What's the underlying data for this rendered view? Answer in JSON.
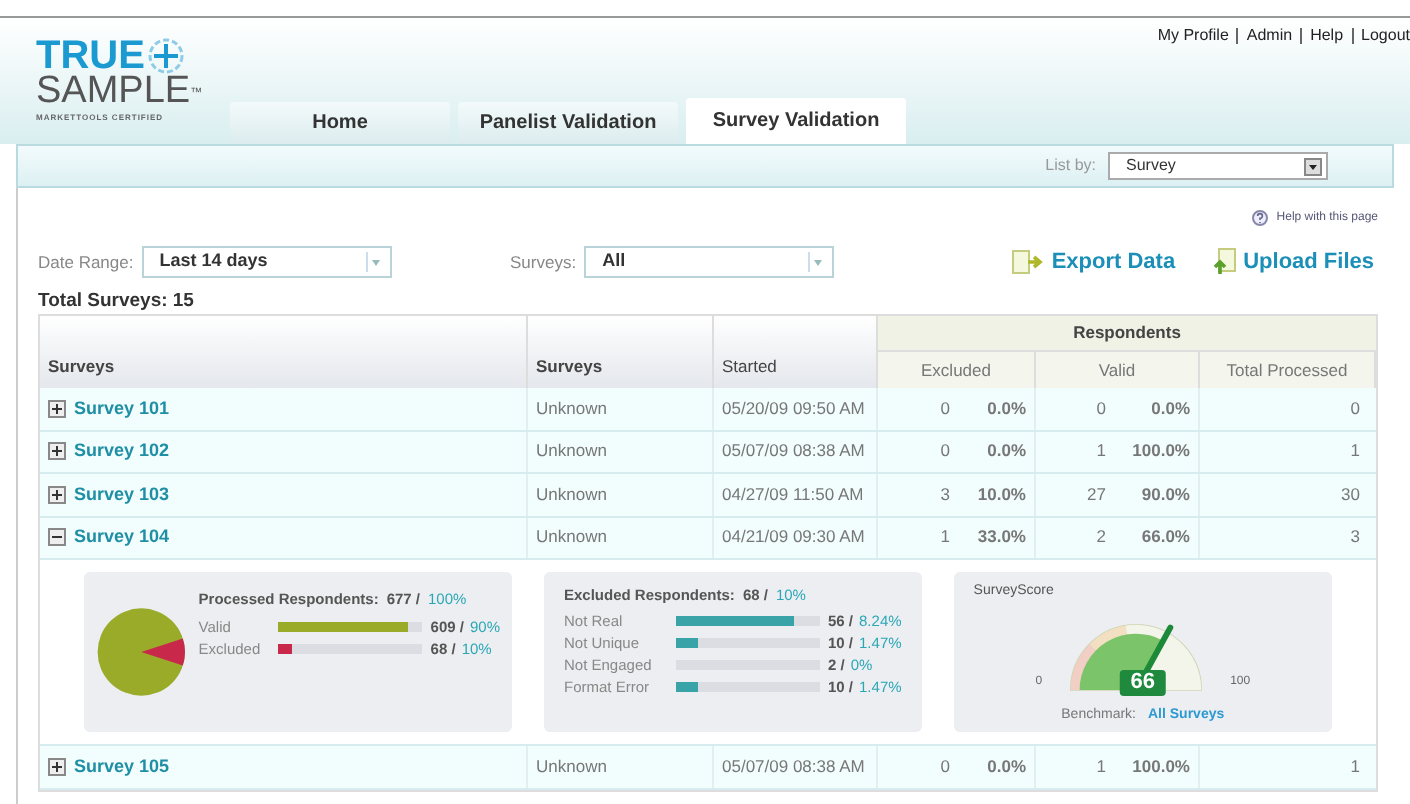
{
  "logo": {
    "line1": "TRUE",
    "line2": "SAMPLE",
    "mark": "™",
    "tagline": "MARKETTOOLS CERTIFIED"
  },
  "top_links": [
    "My Profile",
    "Admin",
    "Help",
    "Logout"
  ],
  "tabs": [
    {
      "label": "Home",
      "selected": false
    },
    {
      "label": "Panelist Validation",
      "selected": false
    },
    {
      "label": "Survey Validation",
      "selected": true
    }
  ],
  "list_by": {
    "label": "List by:",
    "value": "Survey"
  },
  "help_link": "Help with this page",
  "filters": [
    {
      "label": "Date Range:",
      "value": "Last 14 days"
    },
    {
      "label": "Surveys:",
      "value": "All"
    }
  ],
  "actions": [
    {
      "label": "Export Data",
      "kind": "export"
    },
    {
      "label": "Upload Files",
      "kind": "upload"
    }
  ],
  "total": "Total Surveys: 15",
  "table": {
    "columns": [
      "Surveys",
      "Surveys",
      "Started"
    ],
    "group": "Respondents",
    "sub_columns": [
      "Excluded",
      "Valid",
      "Total Processed"
    ],
    "rows": [
      {
        "name": "Survey 101",
        "status": "Unknown",
        "started": "05/20/09 09:50 AM",
        "excluded": "0",
        "excluded_pct": "0.0%",
        "valid": "0",
        "valid_pct": "0.0%",
        "total": "0",
        "expanded": false
      },
      {
        "name": "Survey 102",
        "status": "Unknown",
        "started": "05/07/09 08:38 AM",
        "excluded": "0",
        "excluded_pct": "0.0%",
        "valid": "1",
        "valid_pct": "100.0%",
        "total": "1",
        "expanded": false
      },
      {
        "name": "Survey 103",
        "status": "Unknown",
        "started": "04/27/09 11:50 AM",
        "excluded": "3",
        "excluded_pct": "10.0%",
        "valid": "27",
        "valid_pct": "90.0%",
        "total": "30",
        "expanded": false
      },
      {
        "name": "Survey 104",
        "status": "Unknown",
        "started": "04/21/09 09:30 AM",
        "excluded": "1",
        "excluded_pct": "33.0%",
        "valid": "2",
        "valid_pct": "66.0%",
        "total": "3",
        "expanded": true
      },
      {
        "name": "Survey 105",
        "status": "Unknown",
        "started": "05/07/09 08:38 AM",
        "excluded": "0",
        "excluded_pct": "0.0%",
        "valid": "1",
        "valid_pct": "100.0%",
        "total": "1",
        "expanded": false
      }
    ]
  },
  "detail": {
    "processed": {
      "title": "Processed Respondents:",
      "count": "677 /",
      "pct": "100%",
      "bars": [
        {
          "label": "Valid",
          "count": "609 /",
          "pct": "90%",
          "level": 0.9,
          "color": "#9aab2a"
        },
        {
          "label": "Excluded",
          "count": "68 /",
          "pct": "10%",
          "level": 0.1,
          "color": "#c8284a"
        }
      ]
    },
    "excluded": {
      "title": "Excluded Respondents:",
      "count": "68 /",
      "pct": "10%",
      "bars": [
        {
          "label": "Not Real",
          "count": "56 /",
          "pct": "8.24%",
          "level": 0.82
        },
        {
          "label": "Not Unique",
          "count": "10 /",
          "pct": "1.47%",
          "level": 0.15
        },
        {
          "label": "Not Engaged",
          "count": "2 /",
          "pct": "0%",
          "level": 0.0
        },
        {
          "label": "Format Error",
          "count": "10 /",
          "pct": "1.47%",
          "level": 0.15
        }
      ]
    },
    "score": {
      "title": "SurveyScore",
      "value": "66",
      "min": "0",
      "max": "100",
      "benchmark_label": "Benchmark:",
      "benchmark_link": "All Surveys"
    }
  }
}
